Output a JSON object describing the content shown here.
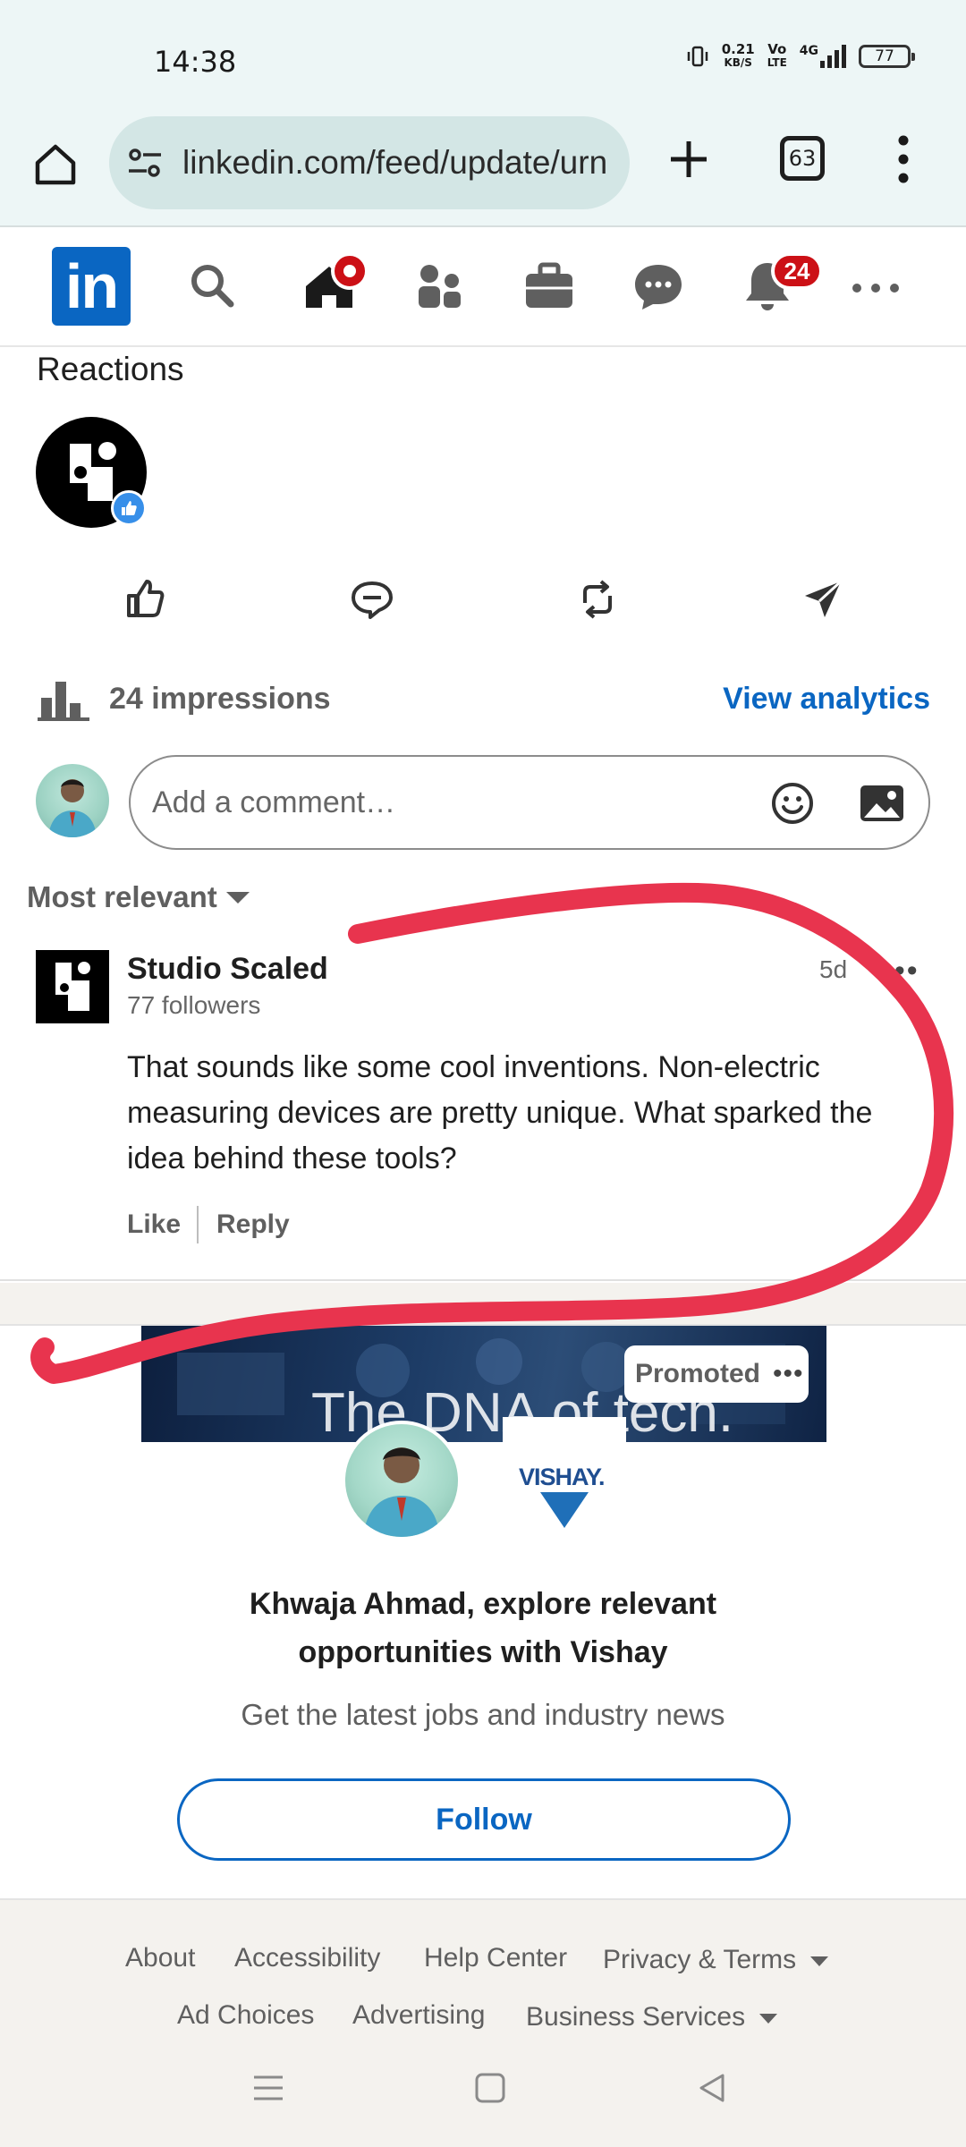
{
  "status_bar": {
    "time": "14:38",
    "net_speed_value": "0.21",
    "net_speed_unit": "KB/S",
    "volte_top": "Vo",
    "volte_bottom": "LTE",
    "network": "4G",
    "battery": "77"
  },
  "browser": {
    "url": "linkedin.com/feed/update/urn",
    "tab_count": "63",
    "icons": [
      "home-icon",
      "site-settings-icon",
      "plus-icon",
      "tabs-icon",
      "more-vert-icon"
    ]
  },
  "linkedin_nav": {
    "logo_text": "in",
    "items": [
      "search-icon",
      "home-icon",
      "network-icon",
      "jobs-icon",
      "messaging-icon",
      "notifications-icon",
      "more-icon"
    ],
    "notifications_badge": "24",
    "accent": "#0a66c2",
    "badge_color": "#cc1016"
  },
  "post": {
    "reactions_title": "Reactions",
    "reaction_icon": "like-icon",
    "actions": [
      "like-icon",
      "comment-icon",
      "repost-icon",
      "send-icon"
    ],
    "impressions": "24 impressions",
    "view_analytics": "View analytics"
  },
  "comment_input": {
    "placeholder": "Add a comment…"
  },
  "comments": {
    "sort_label": "Most relevant",
    "items": [
      {
        "author": "Studio Scaled",
        "followers": "77 followers",
        "time": "5d",
        "text": "That sounds like some cool inventions. Non-electric measuring devices are pretty unique. What sparked the idea behind these tools?",
        "like_label": "Like",
        "reply_label": "Reply"
      }
    ]
  },
  "promoted": {
    "banner_text": "The DNA of tech.",
    "label": "Promoted",
    "company_logo_text": "VISHAY.",
    "title": "Khwaja Ahmad, explore relevant opportunities with Vishay",
    "subtitle": "Get the latest jobs and industry news",
    "follow_label": "Follow"
  },
  "footer": {
    "links": [
      "About",
      "Accessibility",
      "Help Center",
      "Privacy & Terms",
      "Ad Choices",
      "Advertising",
      "Business Services"
    ]
  },
  "annotation_color": "#e8344e"
}
